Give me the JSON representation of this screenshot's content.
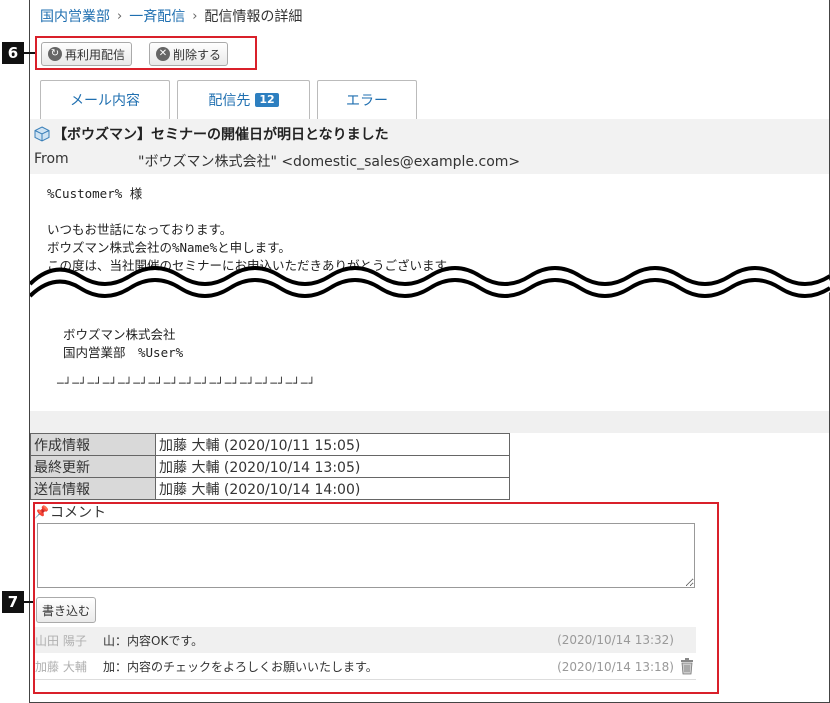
{
  "breadcrumb": {
    "items": [
      "国内営業部",
      "一斉配信"
    ],
    "current": "配信情報の詳細"
  },
  "toolbar": {
    "reuse_label": "再利用配信",
    "delete_label": "削除する"
  },
  "callouts": {
    "toolbar": "6",
    "comment": "7"
  },
  "tabs": [
    {
      "label": "メール内容"
    },
    {
      "label": "配信先",
      "badge": "12"
    },
    {
      "label": "エラー"
    }
  ],
  "mail": {
    "subject": "【ボウズマン】セミナーの開催日が明日となりました",
    "from_label": "From",
    "from_value": "\"ボウズマン株式会社\" <domestic_sales@example.com>",
    "body_lines": [
      "%Customer% 様",
      "",
      "いつもお世話になっております。",
      "ボウズマン株式会社の%Name%と申します。",
      "この度は、当社開催のセミナーにお申込いただきありがとうございます。"
    ],
    "signature_lines": [
      "ボウズマン株式会社",
      "国内営業部　%User%"
    ],
    "footer_line": "─┘─┘─┘─┘─┘─┘─┘─┘─┘─┘─┘─┘─┘─┘─┘─┘─┘"
  },
  "info": [
    {
      "key": "作成情報",
      "value": "加藤 大輔 (2020/10/11 15:05)"
    },
    {
      "key": "最終更新",
      "value": "加藤 大輔 (2020/10/14 13:05)"
    },
    {
      "key": "送信情報",
      "value": "加藤 大輔 (2020/10/14 14:00)"
    }
  ],
  "comment": {
    "title": "コメント",
    "input_value": "",
    "write_label": "書き込む",
    "entries": [
      {
        "author": "山田 陽子",
        "message": "山：内容OKです。",
        "timestamp": "(2020/10/14 13:32)"
      },
      {
        "author": "加藤 大輔",
        "message": "加：内容のチェックをよろしくお願いいたします。",
        "timestamp": "(2020/10/14 13:18)"
      }
    ]
  },
  "colors": {
    "highlight": "#d9202a",
    "link": "#1f6fb0",
    "badge": "#2d7fc0"
  }
}
